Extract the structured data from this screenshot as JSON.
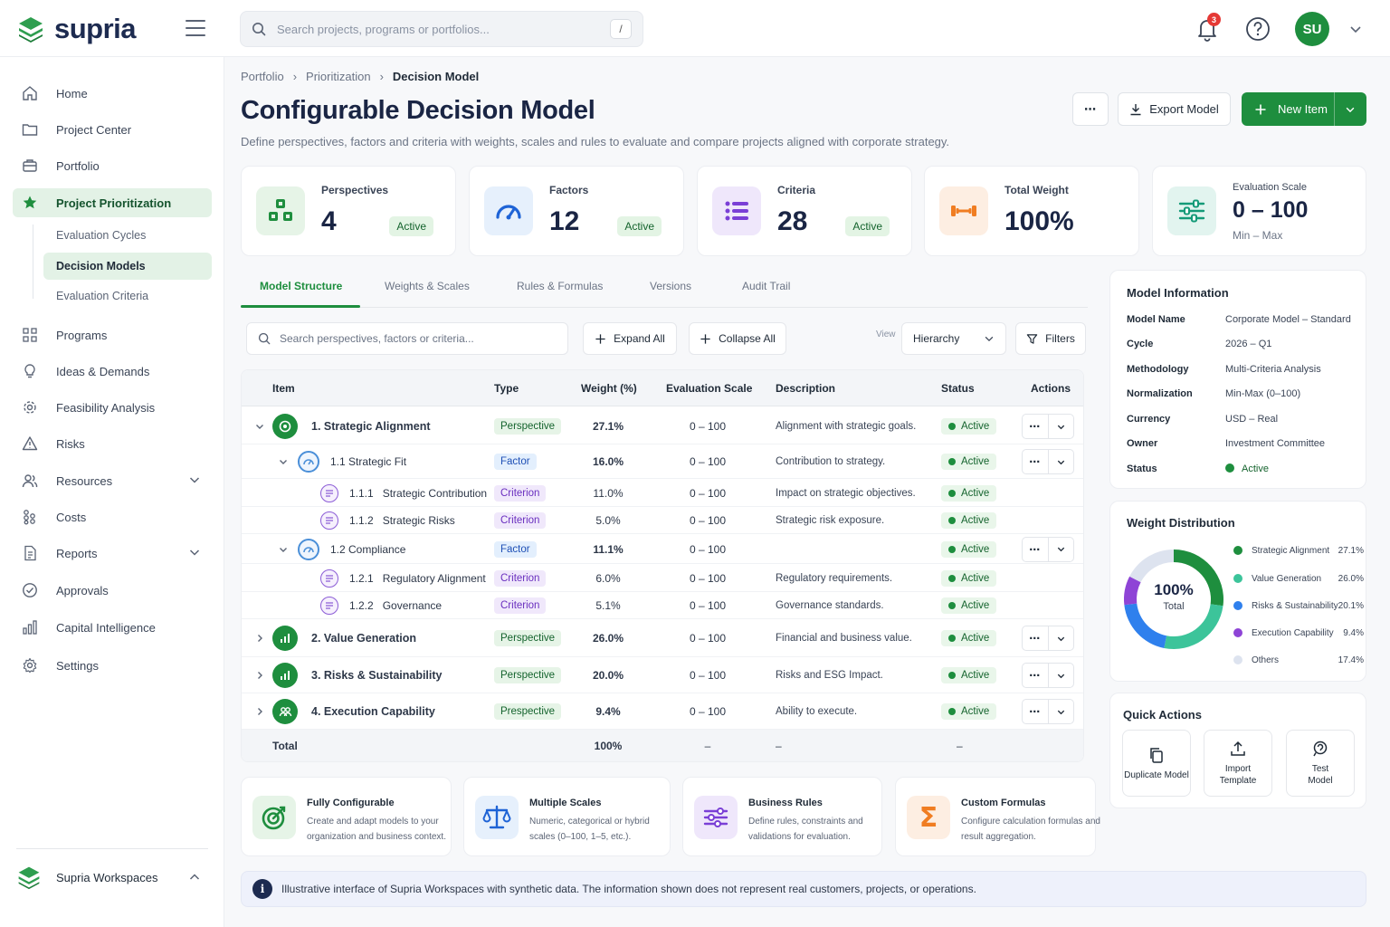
{
  "app": {
    "name": "supria"
  },
  "search": {
    "placeholder": "Search projects, programs or portfolios...",
    "shortcut": "/"
  },
  "header": {
    "notifications_count": "3",
    "user_initials": "SU"
  },
  "sidebar": {
    "items": [
      {
        "label": "Home"
      },
      {
        "label": "Project Center"
      },
      {
        "label": "Portfolio"
      },
      {
        "label": "Project Prioritization"
      },
      {
        "label": "Programs"
      },
      {
        "label": "Ideas & Demands"
      },
      {
        "label": "Feasibility Analysis"
      },
      {
        "label": "Risks"
      },
      {
        "label": "Resources"
      },
      {
        "label": "Costs"
      },
      {
        "label": "Reports"
      },
      {
        "label": "Approvals"
      },
      {
        "label": "Capital Intelligence"
      },
      {
        "label": "Settings"
      }
    ],
    "sub_items": [
      {
        "label": "Evaluation Cycles"
      },
      {
        "label": "Decision Models"
      },
      {
        "label": "Evaluation Criteria"
      }
    ],
    "workspace": "Supria Workspaces"
  },
  "breadcrumb": [
    "Portfolio",
    "Prioritization",
    "Decision Model"
  ],
  "page": {
    "title": "Configurable Decision Model",
    "subtitle": "Define perspectives, factors and criteria with weights, scales and rules to evaluate and compare projects aligned with corporate strategy.",
    "more_label": "⋯",
    "export_label": "Export Model",
    "new_label": "New Item"
  },
  "stats": [
    {
      "label": "Perspectives",
      "value": "4",
      "status": "Active"
    },
    {
      "label": "Factors",
      "value": "12",
      "status": "Active"
    },
    {
      "label": "Criteria",
      "value": "28",
      "status": "Active"
    },
    {
      "label": "Total Weight",
      "value": "100%"
    },
    {
      "label": "Evaluation Scale",
      "value": "0 – 100",
      "sub": "Min – Max"
    }
  ],
  "tabs": [
    "Model Structure",
    "Weights & Scales",
    "Rules & Formulas",
    "Versions",
    "Audit Trail"
  ],
  "toolbar": {
    "search_placeholder": "Search perspectives, factors or criteria...",
    "expand": "Expand All",
    "collapse": "Collapse All",
    "view_label": "View",
    "view_value": "Hierarchy",
    "filters": "Filters"
  },
  "table": {
    "headers": [
      "Item",
      "Type",
      "Weight (%)",
      "Evaluation Scale",
      "Description",
      "Status",
      "Actions"
    ],
    "rows": [
      {
        "item": "1. Strategic Alignment",
        "type": "Perspective",
        "weight": "27.1%",
        "scale": "0 – 100",
        "desc": "Alignment with strategic goals.",
        "status": "Active"
      },
      {
        "item": "1.1 Strategic Fit",
        "type": "Factor",
        "weight": "16.0%",
        "scale": "0 – 100",
        "desc": "Contribution to strategy.",
        "status": "Active"
      },
      {
        "item": "1.1.1   Strategic Contribution",
        "type": "Criterion",
        "weight": "11.0%",
        "scale": "0 – 100",
        "desc": "Impact on strategic objectives.",
        "status": "Active"
      },
      {
        "item": "1.1.2   Strategic Risks",
        "type": "Criterion",
        "weight": "5.0%",
        "scale": "0 – 100",
        "desc": "Strategic risk exposure.",
        "status": "Active"
      },
      {
        "item": "1.2 Compliance",
        "type": "Factor",
        "weight": "11.1%",
        "scale": "0 – 100",
        "desc": "",
        "status": "Active"
      },
      {
        "item": "1.2.1   Regulatory Alignment",
        "type": "Criterion",
        "weight": "6.0%",
        "scale": "0 – 100",
        "desc": "Regulatory requirements.",
        "status": "Active"
      },
      {
        "item": "1.2.2   Governance",
        "type": "Criterion",
        "weight": "5.1%",
        "scale": "0 – 100",
        "desc": "Governance standards.",
        "status": "Active"
      },
      {
        "item": "2. Value Generation",
        "type": "Perspective",
        "weight": "26.0%",
        "scale": "0 – 100",
        "desc": "Financial and business value.",
        "status": "Active"
      },
      {
        "item": "3. Risks & Sustainability",
        "type": "Perspective",
        "weight": "20.0%",
        "scale": "0 – 100",
        "desc": "Risks and ESG Impact.",
        "status": "Active"
      },
      {
        "item": "4. Execution Capability",
        "type": "Prespective",
        "weight": "9.4%",
        "scale": "0 – 100",
        "desc": "Ability to execute.",
        "status": "Active"
      }
    ],
    "total": {
      "label": "Total",
      "weight": "100%",
      "scale": "–",
      "desc": "–",
      "status": "–"
    }
  },
  "features": [
    {
      "title": "Fully Configurable",
      "desc": "Create and adapt models to your organization and business context."
    },
    {
      "title": "Multiple Scales",
      "desc": "Numeric, categorical or hybrid scales (0–100, 1–5, etc.)."
    },
    {
      "title": "Business Rules",
      "desc": "Define rules, constraints and validations for evaluation."
    },
    {
      "title": "Custom Formulas",
      "desc": "Configure calculation formulas and result aggregation."
    }
  ],
  "notice": "Illustrative interface of Supria Workspaces with synthetic data. The information shown does not represent real customers, projects, or operations.",
  "model_info": {
    "title": "Model Information",
    "rows": [
      {
        "k": "Model Name",
        "v": "Corporate Model – Standard"
      },
      {
        "k": "Cycle",
        "v": "2026 – Q1"
      },
      {
        "k": "Methodology",
        "v": "Multi-Criteria Analysis"
      },
      {
        "k": "Normalization",
        "v": "Min-Max (0–100)"
      },
      {
        "k": "Currency",
        "v": "USD – Real"
      },
      {
        "k": "Owner",
        "v": "Investment Committee"
      },
      {
        "k": "Status",
        "v": "Active"
      }
    ]
  },
  "chart_data": {
    "type": "pie",
    "title": "Weight Distribution",
    "center_value": "100%",
    "center_label": "Total",
    "categories": [
      "Strategic Alignment",
      "Value Generation",
      "Risks & Sustainability",
      "Execution Capability",
      "Others"
    ],
    "values": [
      27.1,
      26.0,
      20.1,
      9.4,
      17.4
    ],
    "labels": [
      "27.1%",
      "26.0%",
      "20.1%",
      "9.4%",
      "17.4%"
    ],
    "colors": [
      "#1e8e3e",
      "#3cc49a",
      "#2f80ed",
      "#8e44d6",
      "#dde3ef"
    ]
  },
  "quick_actions": {
    "title": "Quick Actions",
    "items": [
      "Duplicate Model",
      "Import Template",
      "Test Model"
    ]
  },
  "colors": {
    "brand": "#1e8e3e",
    "navy": "#1d2b50"
  }
}
